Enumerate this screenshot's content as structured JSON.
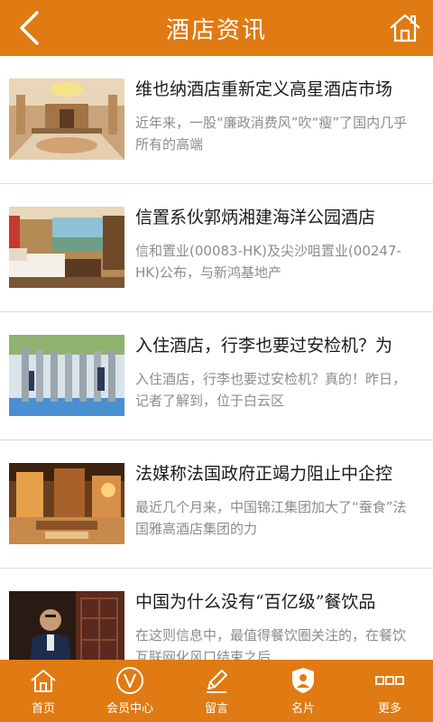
{
  "header": {
    "title": "酒店资讯"
  },
  "articles": [
    {
      "title": "维也纳酒店重新定义高星酒店市场",
      "summary": "近年来，一股“廉政消费风”吹“瘦”了国内几乎所有的高端",
      "image": "hotel-lobby"
    },
    {
      "title": "信置系伙郭炳湘建海洋公园酒店",
      "summary": "信和置业(00083-HK)及尖沙咀置业(00247-HK)公布，与新鸿基地产",
      "image": "hotel-room"
    },
    {
      "title": "入住酒店，行李也要过安检机？为",
      "summary": "入住酒店，行李也要过安检机？真的！昨日，记者了解到，位于白云区",
      "image": "security-gates"
    },
    {
      "title": "法媒称法国政府正竭力阻止中企控",
      "summary": "最近几个月来，中国锦江集团加大了“蚕食”法国雅高酒店集团的力",
      "image": "hotel-interior"
    },
    {
      "title": "中国为什么没有“百亿级”餐饮品",
      "summary": "在这则信息中，最值得餐饮圈关注的，在餐饮互联网化风口结束之后",
      "image": "restaurant-man"
    }
  ],
  "tabbar": [
    {
      "label": "首页",
      "icon": "home-icon"
    },
    {
      "label": "会员中心",
      "icon": "member-icon"
    },
    {
      "label": "留言",
      "icon": "pencil-icon"
    },
    {
      "label": "名片",
      "icon": "card-icon"
    },
    {
      "label": "更多",
      "icon": "more-icon"
    }
  ],
  "colors": {
    "primary": "#e07a12",
    "title_text": "#1a1a1a",
    "summary_text": "#8c8c8c"
  }
}
